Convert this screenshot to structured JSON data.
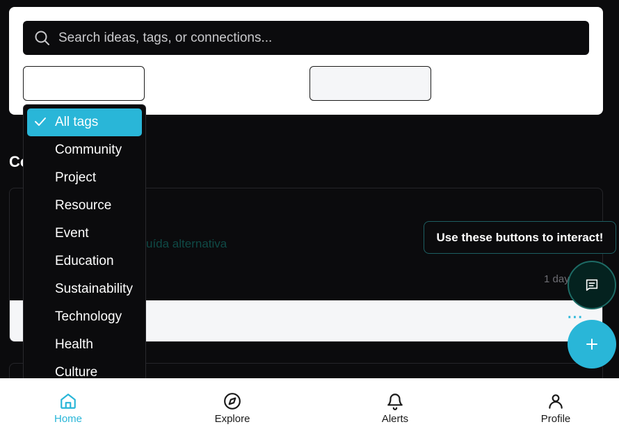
{
  "search": {
    "placeholder": "Search ideas, tags, or connections..."
  },
  "section": {
    "heading": "Co"
  },
  "post": {
    "subtitle": "uída alternativa",
    "time": "1 day",
    "more": "···"
  },
  "tag_dropdown": {
    "selected": "All tags",
    "items": [
      "All tags",
      "Community",
      "Project",
      "Resource",
      "Event",
      "Education",
      "Sustainability",
      "Technology",
      "Health",
      "Culture"
    ]
  },
  "tooltip": {
    "text": "Use these buttons to interact!"
  },
  "fab": {
    "add_symbol": "+"
  },
  "nav": {
    "items": [
      {
        "label": "Home",
        "icon": "home-icon",
        "active": true
      },
      {
        "label": "Explore",
        "icon": "compass-icon",
        "active": false
      },
      {
        "label": "Alerts",
        "icon": "bell-icon",
        "active": false
      },
      {
        "label": "Profile",
        "icon": "user-icon",
        "active": false
      }
    ]
  },
  "colors": {
    "accent": "#29b6d8",
    "background": "#0b0b0d",
    "card": "#ffffff",
    "fab_dark": "#04221f",
    "tooltip_border": "#1d5f62"
  }
}
